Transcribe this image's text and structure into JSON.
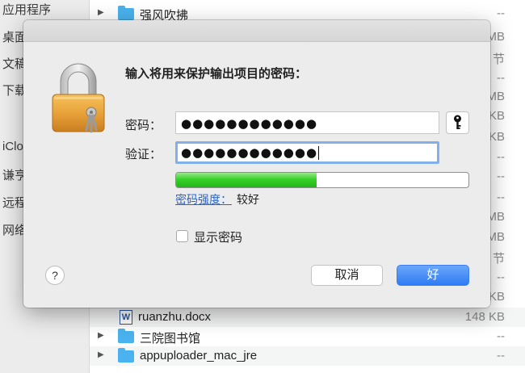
{
  "sidebar": {
    "items": [
      "应用程序",
      "桌面",
      "文稿",
      "下载",
      "iCloud",
      "谦亨",
      "远程",
      "网络"
    ]
  },
  "files": [
    {
      "name": "强风吹拂",
      "size": "--",
      "kind": "folder",
      "expandable": true
    },
    {
      "name": "",
      "size": "MB",
      "kind": "hidden"
    },
    {
      "name": "",
      "size": "节",
      "kind": "hidden"
    },
    {
      "name": "",
      "size": "--",
      "kind": "hidden"
    },
    {
      "name": "",
      "size": "MB",
      "kind": "hidden"
    },
    {
      "name": "",
      "size": "KB",
      "kind": "hidden"
    },
    {
      "name": "",
      "size": "KB",
      "kind": "hidden"
    },
    {
      "name": "",
      "size": "--",
      "kind": "hidden"
    },
    {
      "name": "",
      "size": "--",
      "kind": "hidden"
    },
    {
      "name": "",
      "size": "--",
      "kind": "hidden"
    },
    {
      "name": "",
      "size": "MB",
      "kind": "hidden"
    },
    {
      "name": "",
      "size": "MB",
      "kind": "hidden"
    },
    {
      "name": "",
      "size": "节",
      "kind": "hidden"
    },
    {
      "name": "",
      "size": "--",
      "kind": "hidden"
    },
    {
      "name": "",
      "size": "KB",
      "kind": "hidden"
    },
    {
      "name": "ruanzhu.docx",
      "size": "148 KB",
      "kind": "doc",
      "expandable": false
    },
    {
      "name": "三院图书馆",
      "size": "--",
      "kind": "folder",
      "expandable": true
    },
    {
      "name": "appuploader_mac_jre",
      "size": "--",
      "kind": "folder",
      "expandable": true
    }
  ],
  "dialog": {
    "prompt": "输入将用来保护输出项目的密码：",
    "password_label": "密码：",
    "password_value": "●●●●●●●●●●●●",
    "verify_label": "验证：",
    "verify_value": "●●●●●●●●●●●●",
    "strength_link": "密码强度：",
    "strength_value": "较好",
    "strength_level": 0.48,
    "show_password_label": "显示密码",
    "show_password_checked": false,
    "help_label": "?",
    "cancel_label": "取消",
    "ok_label": "好"
  },
  "icons": {
    "lock": "padlock-with-keys-icon",
    "key": "key-icon",
    "folder": "folder-icon",
    "doc": "word-document-icon"
  },
  "colors": {
    "accent": "#2f7bf3",
    "folder": "#4ab2ee",
    "meter": "#38d12a",
    "link": "#2a66c9",
    "focus_ring": "#82b0e8"
  }
}
